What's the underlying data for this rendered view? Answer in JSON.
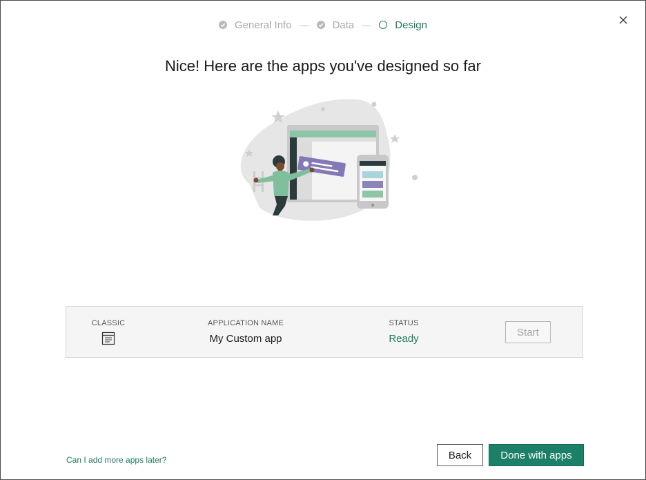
{
  "stepper": {
    "steps": [
      {
        "label": "General Info",
        "state": "done"
      },
      {
        "label": "Data",
        "state": "done"
      },
      {
        "label": "Design",
        "state": "current"
      }
    ],
    "separator": "—"
  },
  "title": "Nice! Here are the apps you've designed so far",
  "app_card": {
    "columns": {
      "classic": "CLASSIC",
      "application_name": "APPLICATION NAME",
      "status": "STATUS"
    },
    "app": {
      "icon": "form-icon",
      "name": "My Custom app",
      "status": "Ready"
    },
    "start_label": "Start"
  },
  "footer": {
    "help_link": "Can I add more apps later?",
    "back_label": "Back",
    "done_label": "Done with apps"
  },
  "colors": {
    "accent": "#1c7f67",
    "accent_text": "#1f7a62",
    "muted": "#a9a9a9",
    "card_bg": "#f4f5f4"
  }
}
